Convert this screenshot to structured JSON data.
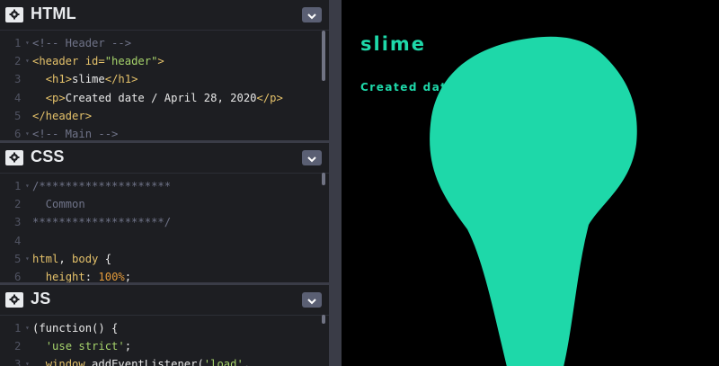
{
  "editors": {
    "html": {
      "title": "HTML",
      "lines": [
        {
          "num": "1",
          "fold": true,
          "parts": [
            {
              "cls": "c-com",
              "text": "<!-- Header -->"
            }
          ]
        },
        {
          "num": "2",
          "fold": true,
          "parts": [
            {
              "cls": "c-tag",
              "text": "<header "
            },
            {
              "cls": "c-attr",
              "text": "id="
            },
            {
              "cls": "c-str",
              "text": "\"header\""
            },
            {
              "cls": "c-tag",
              "text": ">"
            }
          ]
        },
        {
          "num": "3",
          "fold": false,
          "parts": [
            {
              "cls": "c-txt",
              "text": "  "
            },
            {
              "cls": "c-tag",
              "text": "<h1>"
            },
            {
              "cls": "c-txt",
              "text": "slime"
            },
            {
              "cls": "c-tag",
              "text": "</h1>"
            }
          ]
        },
        {
          "num": "4",
          "fold": false,
          "parts": [
            {
              "cls": "c-txt",
              "text": "  "
            },
            {
              "cls": "c-tag",
              "text": "<p>"
            },
            {
              "cls": "c-txt",
              "text": "Created date / April 28, 2020"
            },
            {
              "cls": "c-tag",
              "text": "</p>"
            }
          ]
        },
        {
          "num": "5",
          "fold": false,
          "parts": [
            {
              "cls": "c-tag",
              "text": "</header>"
            }
          ]
        },
        {
          "num": "6",
          "fold": true,
          "parts": [
            {
              "cls": "c-com",
              "text": "<!-- Main -->"
            }
          ]
        }
      ]
    },
    "css": {
      "title": "CSS",
      "lines": [
        {
          "num": "1",
          "fold": true,
          "parts": [
            {
              "cls": "c-com",
              "text": "/********************"
            }
          ]
        },
        {
          "num": "2",
          "fold": false,
          "parts": [
            {
              "cls": "c-com",
              "text": "  Common"
            }
          ]
        },
        {
          "num": "3",
          "fold": false,
          "parts": [
            {
              "cls": "c-com",
              "text": "********************/"
            }
          ]
        },
        {
          "num": "4",
          "fold": false,
          "parts": []
        },
        {
          "num": "5",
          "fold": true,
          "parts": [
            {
              "cls": "c-tag",
              "text": "html"
            },
            {
              "cls": "c-txt",
              "text": ", "
            },
            {
              "cls": "c-tag",
              "text": "body"
            },
            {
              "cls": "c-txt",
              "text": " {"
            }
          ]
        },
        {
          "num": "6",
          "fold": false,
          "parts": [
            {
              "cls": "c-txt",
              "text": "  "
            },
            {
              "cls": "c-attr",
              "text": "height"
            },
            {
              "cls": "c-txt",
              "text": ": "
            },
            {
              "cls": "c-num",
              "text": "100%"
            },
            {
              "cls": "c-txt",
              "text": ";"
            }
          ]
        }
      ]
    },
    "js": {
      "title": "JS",
      "lines": [
        {
          "num": "1",
          "fold": true,
          "parts": [
            {
              "cls": "c-txt",
              "text": "(function() {"
            }
          ]
        },
        {
          "num": "2",
          "fold": false,
          "parts": [
            {
              "cls": "c-txt",
              "text": "  "
            },
            {
              "cls": "c-str",
              "text": "'use strict'"
            },
            {
              "cls": "c-txt",
              "text": ";"
            }
          ]
        },
        {
          "num": "3",
          "fold": true,
          "parts": [
            {
              "cls": "c-txt",
              "text": "  "
            },
            {
              "cls": "c-tag",
              "text": "window"
            },
            {
              "cls": "c-txt",
              "text": ".addEventListener("
            },
            {
              "cls": "c-str",
              "text": "'load'"
            },
            {
              "cls": "c-txt",
              "text": ","
            }
          ]
        }
      ]
    }
  },
  "preview": {
    "title": "slime",
    "date": "Created date / April 28, 2020",
    "accent": "#1ed8a9"
  },
  "icons": {
    "settings": "gear-icon",
    "collapse": "chevron-down-icon"
  }
}
